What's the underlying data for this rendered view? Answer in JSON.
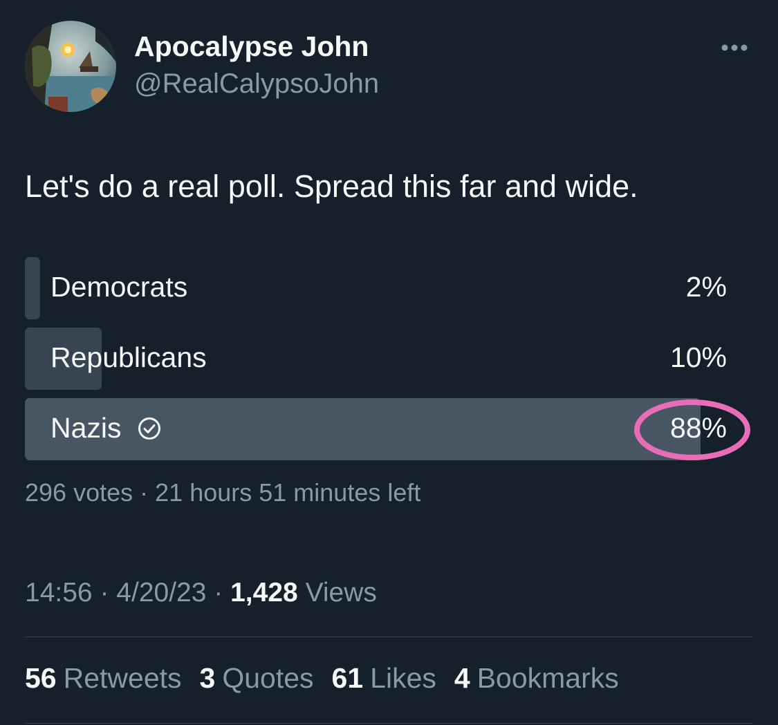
{
  "author": {
    "display_name": "Apocalypse John",
    "handle": "@RealCalypsoJohn"
  },
  "tweet": {
    "text": "Let's do a real poll. Spread this far and wide."
  },
  "poll": {
    "options": [
      {
        "label": "Democrats",
        "percent_text": "2%",
        "share": 0.02,
        "winner": false
      },
      {
        "label": "Republicans",
        "percent_text": "10%",
        "share": 0.1,
        "winner": false
      },
      {
        "label": "Nazis",
        "percent_text": "88%",
        "share": 0.88,
        "winner": true
      }
    ],
    "votes": "296 votes",
    "separator": "·",
    "time_left": "21 hours 51 minutes left"
  },
  "meta": {
    "time": "14:56",
    "separator": "·",
    "date": "4/20/23",
    "views_count": "1,428",
    "views_label": "Views"
  },
  "stats": {
    "retweets_count": "56",
    "retweets_label": "Retweets",
    "quotes_count": "3",
    "quotes_label": "Quotes",
    "likes_count": "61",
    "likes_label": "Likes",
    "bookmarks_count": "4",
    "bookmarks_label": "Bookmarks"
  },
  "icons": {
    "more": "more-horizontal-icon",
    "winner_check": "check-circle-icon",
    "avatar": "avatar-image"
  },
  "colors": {
    "background": "#15202b",
    "text_primary": "#f7f9f9",
    "text_secondary": "#8b98a5",
    "poll_bar": "#38444f",
    "poll_bar_winner": "#485563",
    "highlight": "#e86db7"
  }
}
